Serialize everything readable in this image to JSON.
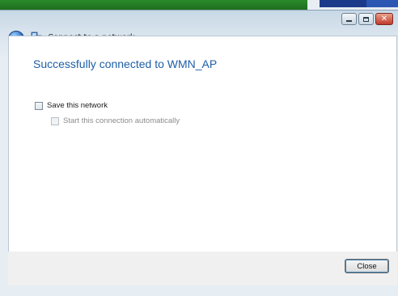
{
  "window": {
    "title": "Connect to a network"
  },
  "icons": {
    "back": "back-arrow-icon",
    "network": "network-icon",
    "minimize": "minimize-icon",
    "maximize": "maximize-icon",
    "close": "close-icon"
  },
  "content": {
    "heading": "Successfully connected to WMN_AP",
    "save_network_label": "Save this network",
    "save_network_checked": false,
    "auto_start_label": "Start this connection automatically",
    "auto_start_checked": false,
    "auto_start_enabled": false
  },
  "footer": {
    "close_label": "Close"
  },
  "colors": {
    "heading": "#1e5fa6",
    "disabled_text": "#8c8c8c"
  }
}
